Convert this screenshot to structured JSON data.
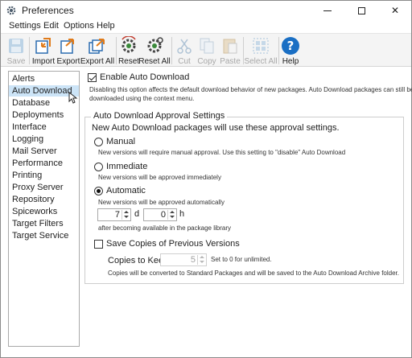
{
  "window": {
    "title": "Preferences",
    "app_icon": "gear-icon",
    "controls": {
      "minimize": "minimize-icon",
      "maximize": "maximize-icon",
      "close": "✕"
    }
  },
  "menu": [
    "Settings",
    "Edit",
    "Options",
    "Help"
  ],
  "toolbar": {
    "buttons": [
      {
        "label": "Save",
        "icon": "save-icon",
        "enabled": false
      },
      {
        "label": "Import",
        "icon": "import-icon",
        "enabled": true
      },
      {
        "label": "Export",
        "icon": "export-icon",
        "enabled": true
      },
      {
        "label": "Export All",
        "icon": "export-all-icon",
        "enabled": true
      },
      {
        "label": "Reset",
        "icon": "reset-icon",
        "enabled": true
      },
      {
        "label": "Reset All",
        "icon": "reset-all-icon",
        "enabled": true
      },
      {
        "label": "Cut",
        "icon": "cut-icon",
        "enabled": false
      },
      {
        "label": "Copy",
        "icon": "copy-icon",
        "enabled": false
      },
      {
        "label": "Paste",
        "icon": "paste-icon",
        "enabled": false
      },
      {
        "label": "Select All",
        "icon": "select-all-icon",
        "enabled": false
      },
      {
        "label": "Help",
        "icon": "help-icon",
        "enabled": true
      }
    ]
  },
  "nav": {
    "selected": "Auto Download",
    "items": [
      "Alerts",
      "Auto Download",
      "Database",
      "Deployments",
      "Interface",
      "Logging",
      "Mail Server",
      "Performance",
      "Printing",
      "Proxy Server",
      "Repository",
      "Spiceworks",
      "Target Filters",
      "Target Service"
    ]
  },
  "auto_download": {
    "enable_label": "Enable Auto Download",
    "enable_checked": true,
    "enable_desc_1": "Disabling this option affects the default download behavior of new packages. Auto Download packages can still be",
    "enable_desc_2": "downloaded using the context menu.",
    "group_title": "Auto Download Approval Settings",
    "group_intro": "New Auto Download packages will use these approval settings.",
    "selected_mode": "Automatic",
    "manual_label": "Manual",
    "manual_desc": "New versions will require manual approval. Use this setting to \"disable\" Auto Download",
    "immediate_label": "Immediate",
    "immediate_desc": "New versions will be approved immediately",
    "automatic_label": "Automatic",
    "automatic_desc": "New versions will be approved automatically",
    "days_value": "7",
    "days_unit": "d",
    "hours_value": "0",
    "hours_unit": "h",
    "after_text": "after becoming available in the package library",
    "save_copies_label": "Save Copies of Previous Versions",
    "save_copies_checked": false,
    "copies_label": "Copies to Keep",
    "copies_value": "5",
    "copies_hint": "Set to 0 for unlimited.",
    "copies_desc": "Copies will be converted to Standard Packages and will be saved to the Auto Download Archive folder."
  }
}
